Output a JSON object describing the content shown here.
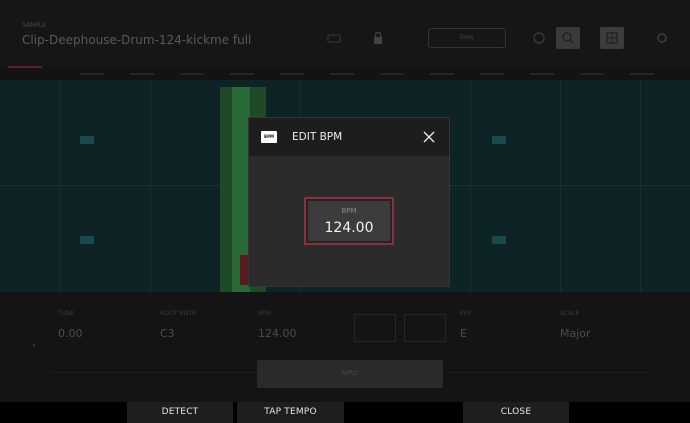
{
  "background": {
    "file_label": "SAMPLE",
    "file_name": "Clip-Deephouse-Drum-124-kickme full",
    "tool_label": "Tools",
    "params": [
      {
        "label": "TUNE",
        "value": "0.00"
      },
      {
        "label": "ROOT NOTE",
        "value": "C3"
      },
      {
        "label": "BPM",
        "value": "124.00"
      },
      {
        "label": "KEY",
        "value": "E"
      },
      {
        "label": "SCALE",
        "value": "Major"
      }
    ],
    "apply_label": "APPLY"
  },
  "modal": {
    "badge": "BPM",
    "title": "EDIT BPM",
    "close_icon": "close-icon",
    "field_label": "BPM",
    "field_value": "124.00"
  },
  "softkeys": {
    "detect": "DETECT",
    "tap_tempo": "TAP TEMPO",
    "close": "CLOSE"
  },
  "colors": {
    "accent": "#8b2e3d",
    "modal_bg": "#2b2b2b",
    "modal_header_bg": "#1d1d1d",
    "softkey_bg": "#1e1e1e"
  }
}
